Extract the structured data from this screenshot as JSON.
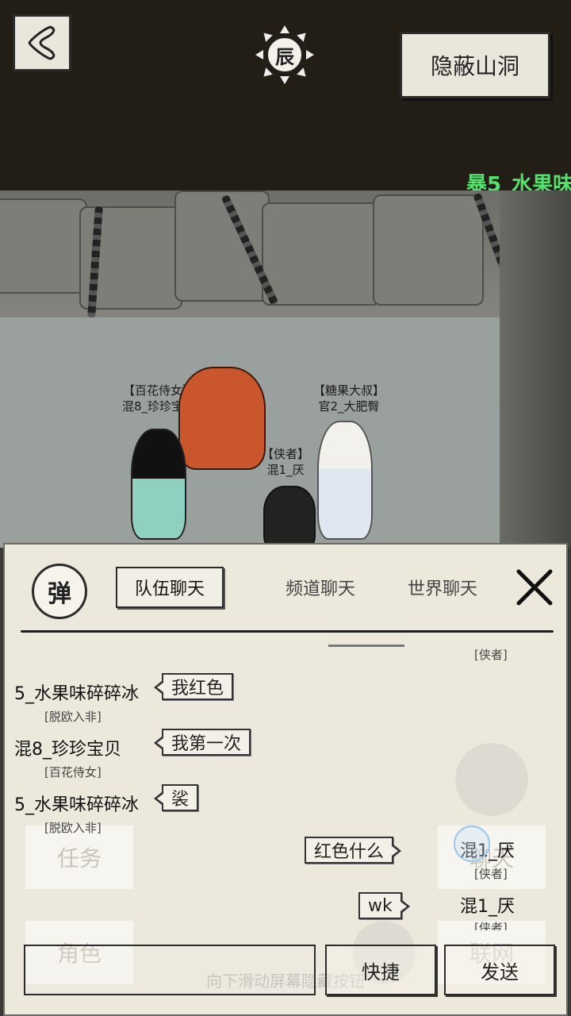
{
  "topbar": {
    "time_symbol": "辰",
    "location": "隐蔽山洞",
    "marquee": "暴5_水果味"
  },
  "scene": {
    "npc1": {
      "title": "【百花侍女】",
      "name": "混8_珍珍宝贝"
    },
    "npc2": {
      "title": "【糖果大叔】",
      "name": "官2_大肥臀"
    },
    "npc3": {
      "title": "【侠者】",
      "name": "混1_厌"
    }
  },
  "chat": {
    "logo_char": "弹",
    "tabs": [
      {
        "label": "队伍聊天",
        "active": true
      },
      {
        "label": "频道聊天",
        "active": false
      },
      {
        "label": "世界聊天",
        "active": false
      }
    ],
    "top_partial_title": "[侠者]",
    "messages": [
      {
        "name": "5_水果味碎碎冰",
        "title": "[脱欧入非]",
        "text": "我红色",
        "side": "left"
      },
      {
        "name": "混8_珍珍宝贝",
        "title": "[百花侍女]",
        "text": "我第一次",
        "side": "left"
      },
      {
        "name": "5_水果味碎碎冰",
        "title": "[脱欧入非]",
        "text": "裟",
        "side": "left"
      },
      {
        "name": "混1_厌",
        "title": "[侠者]",
        "text": "红色什么",
        "side": "right"
      },
      {
        "name": "混1_厌",
        "title": "[侠者]",
        "text": "wk",
        "side": "right"
      }
    ],
    "quick_label": "快捷",
    "send_label": "发送"
  },
  "background_menu": {
    "task": "任务",
    "role": "角色",
    "chat": "聊天",
    "network": "联网",
    "hint": "向下滑动屏幕隐藏按钮"
  },
  "colors": {
    "marquee": "#55e06d",
    "panel_bg": "#ece8dc",
    "topbar_bg": "#221e16"
  }
}
